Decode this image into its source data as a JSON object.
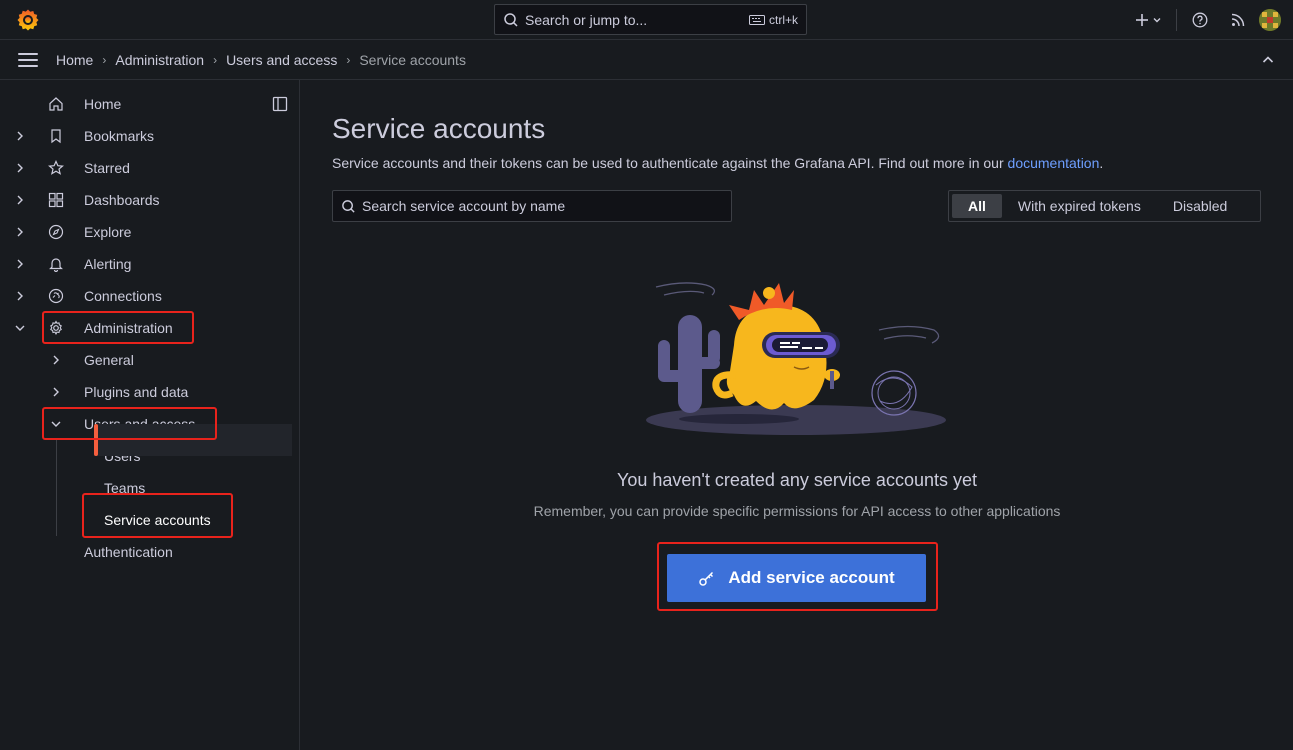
{
  "topbar": {
    "search_placeholder": "Search or jump to...",
    "shortcut": "ctrl+k",
    "icons": [
      "grafana-logo",
      "search-icon",
      "keyboard-icon",
      "plus-icon",
      "chevron-down-icon",
      "help-icon",
      "rss-icon",
      "avatar"
    ]
  },
  "breadcrumb": {
    "items": [
      "Home",
      "Administration",
      "Users and access",
      "Service accounts"
    ]
  },
  "sidebar": {
    "items": [
      {
        "label": "Home",
        "icon": "home-icon"
      },
      {
        "label": "Bookmarks",
        "icon": "bookmark-icon"
      },
      {
        "label": "Starred",
        "icon": "star-icon"
      },
      {
        "label": "Dashboards",
        "icon": "apps-icon"
      },
      {
        "label": "Explore",
        "icon": "compass-icon"
      },
      {
        "label": "Alerting",
        "icon": "bell-icon"
      },
      {
        "label": "Connections",
        "icon": "link-icon"
      },
      {
        "label": "Administration",
        "icon": "cog-icon"
      }
    ],
    "admin_children": [
      "General",
      "Plugins and data",
      "Users and access",
      "Authentication"
    ],
    "users_children": [
      "Users",
      "Teams",
      "Service accounts"
    ]
  },
  "main": {
    "title": "Service accounts",
    "description": "Service accounts and their tokens can be used to authenticate against the Grafana API. Find out more in our ",
    "description_link": "documentation",
    "description_end": ".",
    "search_placeholder": "Search service account by name",
    "filters": [
      "All",
      "With expired tokens",
      "Disabled"
    ],
    "empty_title": "You haven't created any service accounts yet",
    "empty_subtitle": "Remember, you can provide specific permissions for API access to other applications",
    "add_button": "Add service account"
  },
  "colors": {
    "accent": "#f55f3e",
    "primary_button": "#3d71d9",
    "highlight": "#e8231c",
    "link": "#6e9fff"
  }
}
